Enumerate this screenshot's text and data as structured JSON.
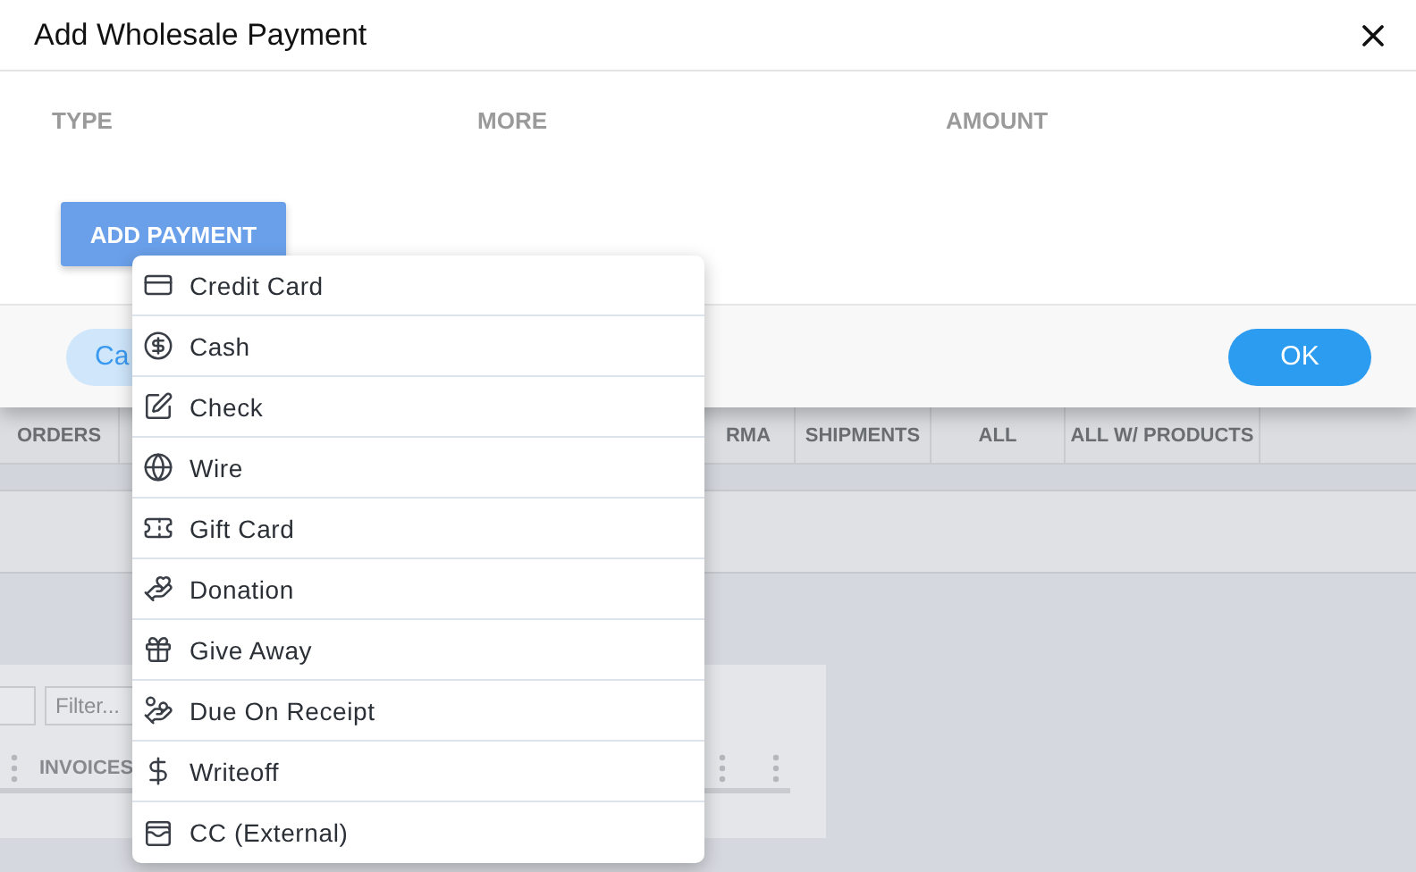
{
  "dialog": {
    "title": "Add Wholesale Payment",
    "columns": [
      "TYPE",
      "MORE",
      "AMOUNT"
    ],
    "add_button": "ADD PAYMENT",
    "cancel_button": "Ca",
    "ok_button": "OK"
  },
  "menu": {
    "items": [
      {
        "label": "Credit Card"
      },
      {
        "label": "Cash"
      },
      {
        "label": "Check"
      },
      {
        "label": "Wire"
      },
      {
        "label": "Gift Card"
      },
      {
        "label": "Donation"
      },
      {
        "label": "Give Away"
      },
      {
        "label": "Due On Receipt"
      },
      {
        "label": "Writeoff"
      },
      {
        "label": "CC (External)"
      }
    ]
  },
  "background": {
    "tabs_left": [
      "ORDERS"
    ],
    "tabs_right": [
      "RMA",
      "SHIPMENTS",
      "ALL",
      "ALL W/ PRODUCTS"
    ],
    "filter": {
      "placeholder": "Filter..."
    },
    "column_header": "INVOICES"
  }
}
